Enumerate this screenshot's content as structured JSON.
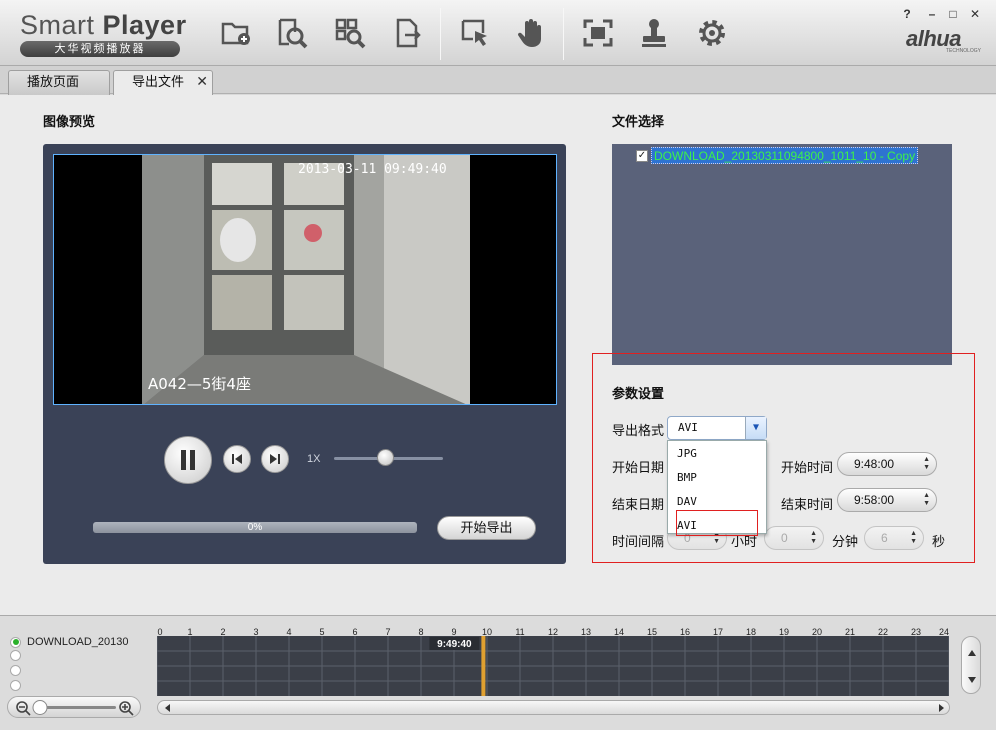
{
  "app": {
    "title_light": "Smart ",
    "title_bold": "Player",
    "subtitle": "大华视频播放器",
    "brand": "alhua",
    "brand_small": "TECHNOLOGY",
    "window_controls": [
      "?",
      "–",
      "□",
      "✕"
    ]
  },
  "toolbar": {
    "buttons": [
      "add-file-icon",
      "search-icon",
      "smart-search-icon",
      "export-icon",
      "select-area-icon",
      "hand-icon",
      "fullscreen-icon",
      "stamp-icon",
      "settings-icon"
    ]
  },
  "tabs": [
    {
      "label": "播放页面",
      "active": false
    },
    {
      "label": "导出文件",
      "active": true
    }
  ],
  "tab_close": "✕",
  "preview": {
    "title": "图像预览",
    "osd_time": "2013-03-11  09:49:40",
    "osd_location": "A042—5街4座",
    "speed": "1X",
    "speed_slider_fraction": 0.5,
    "progress_text": "0%",
    "progress_fraction": 0.0,
    "export_button": "开始导出"
  },
  "file_select": {
    "title": "文件选择",
    "files": [
      {
        "name": "DOWNLOAD_20130311094800_1011_10 - Copy",
        "checked": true
      }
    ]
  },
  "params": {
    "title": "参数设置",
    "format_label": "导出格式",
    "format_value": "AVI",
    "format_options": [
      "JPG",
      "BMP",
      "DAV",
      "AVI"
    ],
    "start_date_label": "开始日期",
    "end_date_label": "结束日期",
    "start_time_label": "开始时间",
    "start_time": "9:48:00",
    "end_time_label": "结束时间",
    "end_time": "9:58:00",
    "interval_label": "时间间隔",
    "interval_hours": "0",
    "hours_unit": "小时",
    "interval_minutes": "0",
    "minutes_unit": "分钟",
    "interval_seconds": "6",
    "seconds_unit": "秒"
  },
  "timeline": {
    "channel": "DOWNLOAD_20130",
    "hours": [
      "0",
      "1",
      "2",
      "3",
      "4",
      "5",
      "6",
      "7",
      "8",
      "9",
      "10",
      "11",
      "12",
      "13",
      "14",
      "15",
      "16",
      "17",
      "18",
      "19",
      "20",
      "21",
      "22",
      "23",
      "24"
    ],
    "cursor_time": "9:49:40",
    "cursor_hour": 9.83
  },
  "colors": {
    "panel_dark": "#3a4257",
    "file_panel": "#5a627a",
    "highlight_red": "#e02020",
    "file_text": "#3df24a",
    "cursor": "#e0a030"
  }
}
